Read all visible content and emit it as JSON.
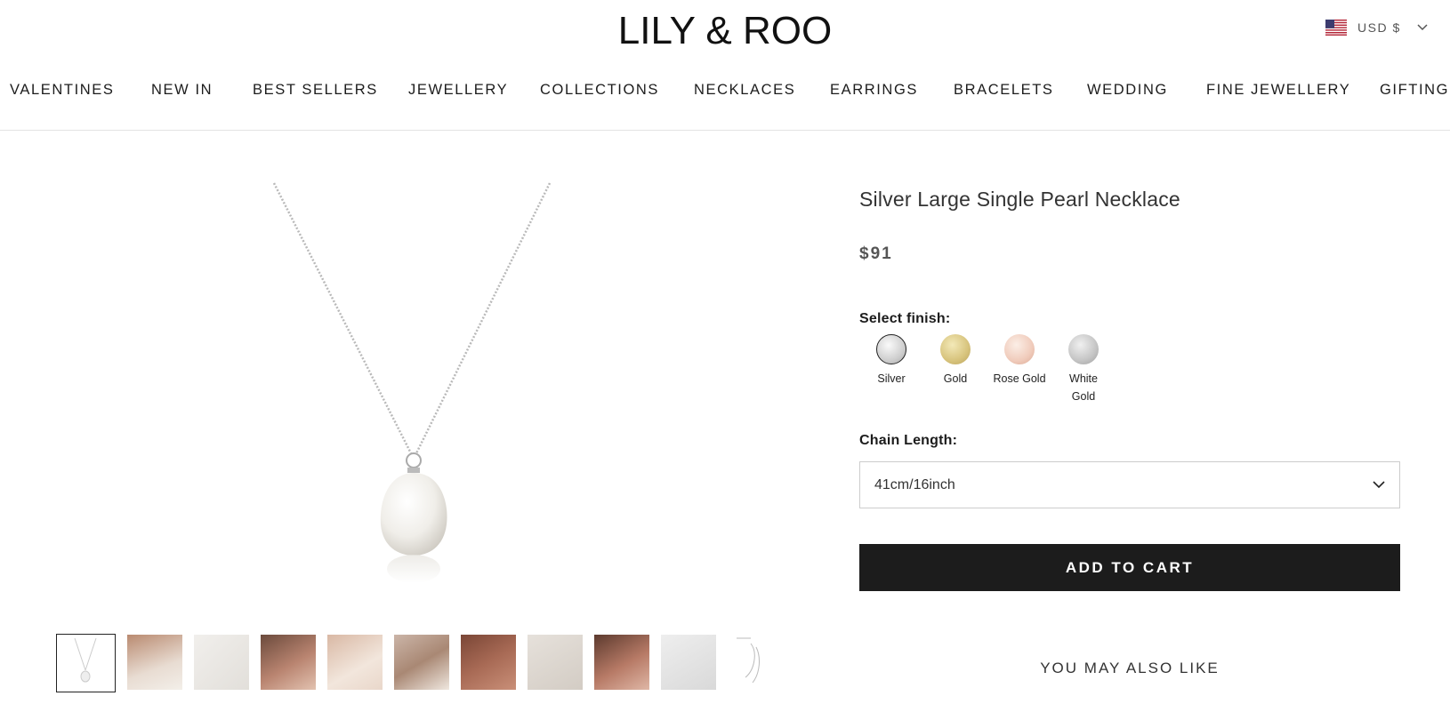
{
  "header": {
    "logo": "LILY & ROO",
    "currency": "USD $",
    "flag_icon": "us-flag-icon"
  },
  "nav": {
    "items": [
      "VALENTINES",
      "NEW IN",
      "BEST SELLERS",
      "JEWELLERY",
      "COLLECTIONS",
      "NECKLACES",
      "EARRINGS",
      "BRACELETS",
      "WEDDING",
      "FINE JEWELLERY",
      "GIFTING"
    ]
  },
  "product": {
    "title": "Silver Large Single Pearl Necklace",
    "price": "$91",
    "finish_label": "Select finish:",
    "finishes": [
      {
        "name": "Silver",
        "color": "#d6d6d6",
        "selected": true
      },
      {
        "name": "Gold",
        "color": "#d9c98a",
        "selected": false
      },
      {
        "name": "Rose Gold",
        "color": "#f2d2c4",
        "selected": false
      },
      {
        "name": "White Gold",
        "color": "#c9c9c9",
        "selected": false
      }
    ],
    "chain_label": "Chain Length:",
    "chain_value": "41cm/16inch",
    "add_to_cart": "ADD TO CART",
    "also_like": "YOU MAY ALSO LIKE"
  },
  "thumbnails_count": 11,
  "colors": {
    "button": "#1c1c1c",
    "text": "#1c1c1c"
  }
}
